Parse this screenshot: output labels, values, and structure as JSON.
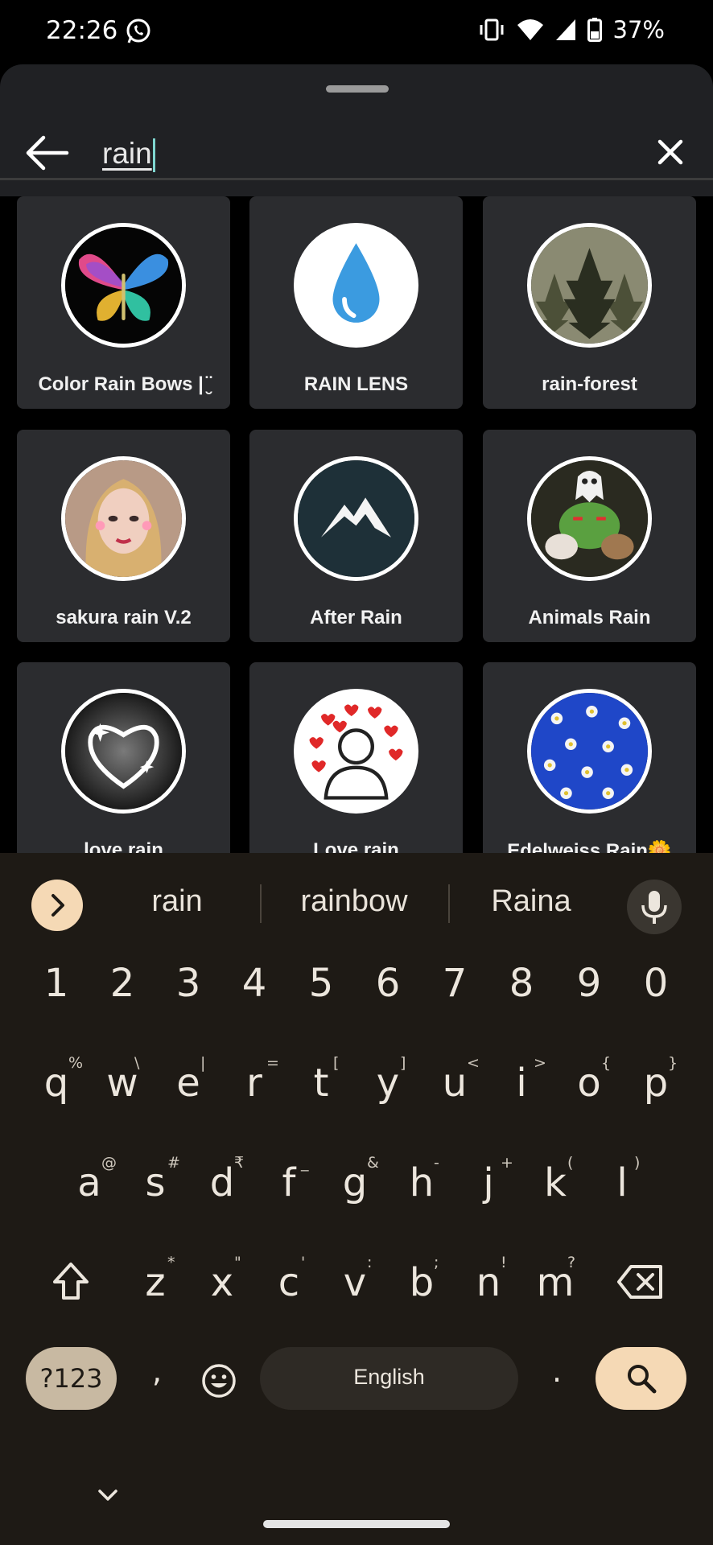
{
  "status_bar": {
    "time": "22:26",
    "battery": "37%"
  },
  "search": {
    "query": "rain"
  },
  "results": [
    {
      "label": "Color Rain Bows | ̮̈"
    },
    {
      "label": "RAIN LENS"
    },
    {
      "label": "rain-forest"
    },
    {
      "label": "sakura rain V.2"
    },
    {
      "label": "After Rain"
    },
    {
      "label": "Animals Rain"
    },
    {
      "label": "love rain"
    },
    {
      "label": "Love rain"
    },
    {
      "label": "Edelweiss Rain🌼"
    }
  ],
  "keyboard": {
    "suggestions": [
      "rain",
      "rainbow",
      "Raina"
    ],
    "digits": [
      "1",
      "2",
      "3",
      "4",
      "5",
      "6",
      "7",
      "8",
      "9",
      "0"
    ],
    "row1": [
      "q",
      "w",
      "e",
      "r",
      "t",
      "y",
      "u",
      "i",
      "o",
      "p"
    ],
    "row1_hints": [
      "%",
      "\\",
      "|",
      "=",
      "[",
      "]",
      "<",
      ">",
      "{",
      "}"
    ],
    "row2": [
      "a",
      "s",
      "d",
      "f",
      "g",
      "h",
      "j",
      "k",
      "l"
    ],
    "row2_hints": [
      "@",
      "#",
      "₹",
      "_",
      "&",
      "-",
      "+",
      "(",
      ")"
    ],
    "row3": [
      "z",
      "x",
      "c",
      "v",
      "b",
      "n",
      "m"
    ],
    "row3_hints": [
      "*",
      "\"",
      "'",
      ":",
      ";",
      "!",
      "?"
    ],
    "symbols_key": "?123",
    "comma_key": ",",
    "space_label": "English",
    "period_key": "."
  },
  "colors": {
    "sheet_bg": "#202124",
    "card_bg": "#2b2c2f",
    "keyboard_bg": "#1e1a15",
    "accent_key": "#f5d9b5"
  }
}
